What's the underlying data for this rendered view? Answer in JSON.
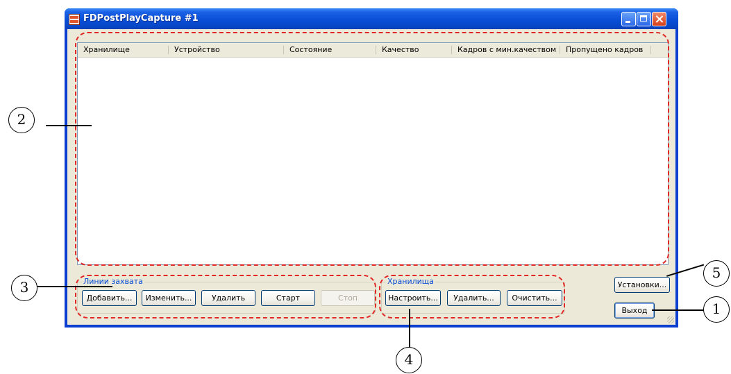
{
  "window": {
    "title": "FDPostPlayCapture #1"
  },
  "list": {
    "columns": [
      "Хранилище",
      "Устройство",
      "Состояние",
      "Качество",
      "Кадров с мин.качеством",
      "Пропущено кадров"
    ]
  },
  "capture_lines": {
    "label": "Линии захвата",
    "buttons": {
      "add": "Добавить...",
      "edit": "Изменить...",
      "delete": "Удалить",
      "start": "Старт",
      "stop": "Стоп"
    }
  },
  "storages": {
    "label": "Хранилища",
    "buttons": {
      "configure": "Настроить...",
      "delete": "Удалить...",
      "clear": "Очистить..."
    }
  },
  "settings_button": "Установки...",
  "exit_button": "Выход",
  "callouts": [
    "1",
    "2",
    "3",
    "4",
    "5"
  ],
  "colors": {
    "callout_dash": "#e22727",
    "group_label": "#0046d5",
    "titlebar": "#0a4fd6"
  }
}
